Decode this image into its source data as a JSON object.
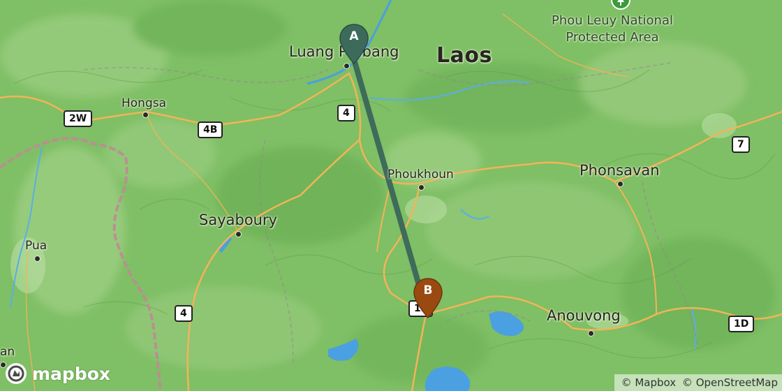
{
  "map": {
    "country_label": "Laos",
    "places": {
      "luang_prabang": "Luang Prabang",
      "hongsa": "Hongsa",
      "phoukhoun": "Phoukhoun",
      "phonsavan": "Phonsavan",
      "sayaboury": "Sayaboury",
      "pua": "Pua",
      "anouvong": "Anouvong",
      "edge_partial": "an"
    },
    "protected_area": "Phou Leuy National Protected Area",
    "protected_area_line1": "Phou Leuy National",
    "protected_area_line2": "Protected Area",
    "road_shields": {
      "r4_north": "4",
      "r2w": "2W",
      "r4b": "4B",
      "r7": "7",
      "r4_south": "4",
      "r1d": "1D",
      "r13": "13"
    }
  },
  "route": {
    "start_marker": "A",
    "end_marker": "B",
    "line_color": "#3e6b5a",
    "start_color": "#3d6b5b",
    "end_color": "#9a4a11"
  },
  "branding": {
    "logo_text": "mapbox",
    "attribution_mapbox": "© Mapbox",
    "attribution_osm": "© OpenStreetMap"
  },
  "colors": {
    "land": "#7fbf65",
    "water": "#4aa0e0",
    "road": "#f2b458",
    "border": "#c08a94"
  }
}
